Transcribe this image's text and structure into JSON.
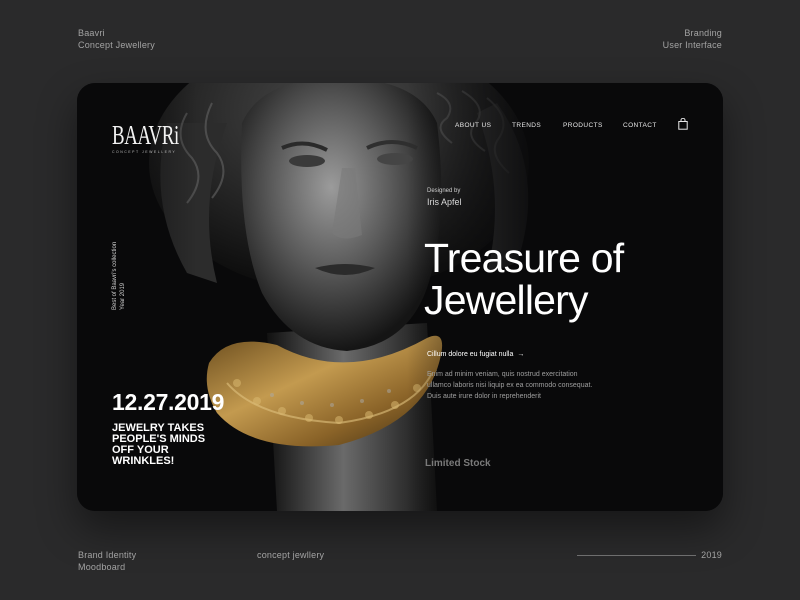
{
  "meta": {
    "top_left": [
      "Baavri",
      "Concept Jewellery"
    ],
    "top_right": [
      "Branding",
      "User Interface"
    ],
    "bottom_left": [
      "Brand Identity",
      "Moodboard"
    ],
    "bottom_center": "concept jewllery",
    "bottom_right": "2019"
  },
  "brand": {
    "logo": "BAAVRi",
    "logo_sub": "CONCEPT JEWELLERY"
  },
  "nav": {
    "items": [
      "ABOUT US",
      "TRENDS",
      "PRODUCTS",
      "CONTACT"
    ],
    "cart_icon": "shopping-bag-icon"
  },
  "side_note": [
    "Best of Baavri's collection",
    "Year 2019"
  ],
  "hero": {
    "date": "12.27.2019",
    "tagline": [
      "JEWELRY TAKES",
      "PEOPLE'S MINDS",
      "OFF YOUR",
      "WRINKLES!"
    ],
    "designed_label": "Designed by",
    "designer": "Iris Apfel",
    "headline": [
      "Treasure of",
      "Jewellery"
    ],
    "cta": "Cillum dolore eu fugiat nulla",
    "cta_icon": "arrow-right-icon",
    "body": [
      "Enim ad minim veniam, quis nostrud exercitation",
      "ullamco laboris nisi liquip ex ea commodo consequat.",
      "Duis aute irure dolor in reprehenderit"
    ],
    "stock": "Limited Stock"
  },
  "colors": {
    "page_bg": "#2a2a2b",
    "card_bg": "#09090a",
    "gold": "#b08a45"
  }
}
